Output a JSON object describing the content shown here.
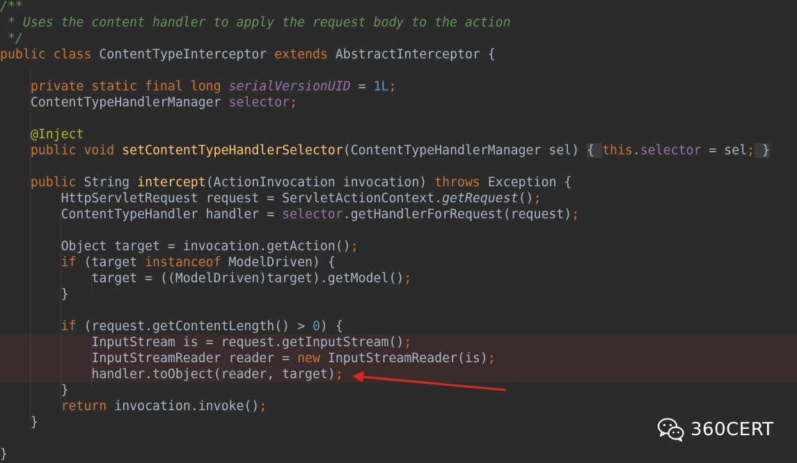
{
  "watermark": {
    "text": "360CERT",
    "icon": "wechat-icon"
  },
  "colors": {
    "background": "#2b2b2b",
    "keyword": "#cc7832",
    "comment": "#629755",
    "field": "#9876aa",
    "method": "#ffc66d",
    "number": "#6897bb",
    "annotation": "#bbb529",
    "highlight": "#3a2c2c",
    "arrow": "#e0241e"
  },
  "lines": [
    [
      [
        "/**",
        "cm"
      ]
    ],
    [
      [
        " * Uses the content handler to apply the request body to the action",
        "cm"
      ]
    ],
    [
      [
        " */",
        "cm"
      ]
    ],
    [
      [
        "public class ",
        "k"
      ],
      [
        "ContentTypeInterceptor ",
        "t"
      ],
      [
        "extends ",
        "k"
      ],
      [
        "AbstractInterceptor {",
        "t"
      ]
    ],
    [],
    [
      [
        "    "
      ],
      [
        "private static final long ",
        "k"
      ],
      [
        "serialVersionUID",
        "fi"
      ],
      [
        " = ",
        "t"
      ],
      [
        "1L",
        "n"
      ],
      [
        ";",
        "k"
      ]
    ],
    [
      [
        "    "
      ],
      [
        "ContentTypeHandlerManager ",
        "t"
      ],
      [
        "selector",
        "f"
      ],
      [
        ";",
        "k"
      ]
    ],
    [],
    [
      [
        "    "
      ],
      [
        "@Inject",
        "a"
      ]
    ],
    [
      [
        "    "
      ],
      [
        "public void ",
        "k"
      ],
      [
        "setContentTypeHandlerSelector",
        "m"
      ],
      [
        "(ContentTypeHandlerManager sel) ",
        "t"
      ],
      [
        "{ ",
        "b"
      ],
      [
        "this",
        "k"
      ],
      [
        ".",
        "t"
      ],
      [
        "selector",
        "f"
      ],
      [
        " = sel",
        "t"
      ],
      [
        ";",
        "k"
      ],
      [
        " }",
        "b"
      ]
    ],
    [],
    [
      [
        "    "
      ],
      [
        "public ",
        "k"
      ],
      [
        "String ",
        "t"
      ],
      [
        "intercept",
        "m"
      ],
      [
        "(ActionInvocation invocation) ",
        "t"
      ],
      [
        "throws ",
        "k"
      ],
      [
        "Exception {",
        "t"
      ]
    ],
    [
      [
        "        "
      ],
      [
        "HttpServletRequest request = ServletActionContext.",
        "t"
      ],
      [
        "getRequest",
        "si"
      ],
      [
        "()",
        "t"
      ],
      [
        ";",
        "k"
      ]
    ],
    [
      [
        "        "
      ],
      [
        "ContentTypeHandler handler = ",
        "t"
      ],
      [
        "selector",
        "f"
      ],
      [
        ".getHandlerForRequest(request)",
        "t"
      ],
      [
        ";",
        "k"
      ]
    ],
    [],
    [
      [
        "        "
      ],
      [
        "Object target = invocation.getAction()",
        "t"
      ],
      [
        ";",
        "k"
      ]
    ],
    [
      [
        "        "
      ],
      [
        "if ",
        "k"
      ],
      [
        "(target ",
        "t"
      ],
      [
        "instanceof ",
        "k"
      ],
      [
        "ModelDriven) {",
        "t"
      ]
    ],
    [
      [
        "            "
      ],
      [
        "target = ((ModelDriven)target).getModel()",
        "t"
      ],
      [
        ";",
        "k"
      ]
    ],
    [
      [
        "        "
      ],
      [
        "}",
        "t"
      ]
    ],
    [],
    [
      [
        "        "
      ],
      [
        "if ",
        "k"
      ],
      [
        "(request.getContentLength() > ",
        "t"
      ],
      [
        "0",
        "n"
      ],
      [
        ") {",
        "t"
      ]
    ],
    [
      [
        "            "
      ],
      [
        "InputStream is = request.getInputStream()",
        "t"
      ],
      [
        ";",
        "k"
      ]
    ],
    [
      [
        "            "
      ],
      [
        "InputStreamReader reader = ",
        "t"
      ],
      [
        "new ",
        "k"
      ],
      [
        "InputStreamReader(is)",
        "t"
      ],
      [
        ";",
        "k"
      ]
    ],
    [
      [
        "            "
      ],
      [
        "handler.toObject(reader, target)",
        "t"
      ],
      [
        ";",
        "k"
      ]
    ],
    [
      [
        "        "
      ],
      [
        "}",
        "t"
      ]
    ],
    [
      [
        "        "
      ],
      [
        "return ",
        "k"
      ],
      [
        "invocation.invoke()",
        "t"
      ],
      [
        ";",
        "k"
      ]
    ],
    [
      [
        "    "
      ],
      [
        "}",
        "t"
      ]
    ],
    [],
    [
      [
        "}",
        "t"
      ]
    ]
  ]
}
